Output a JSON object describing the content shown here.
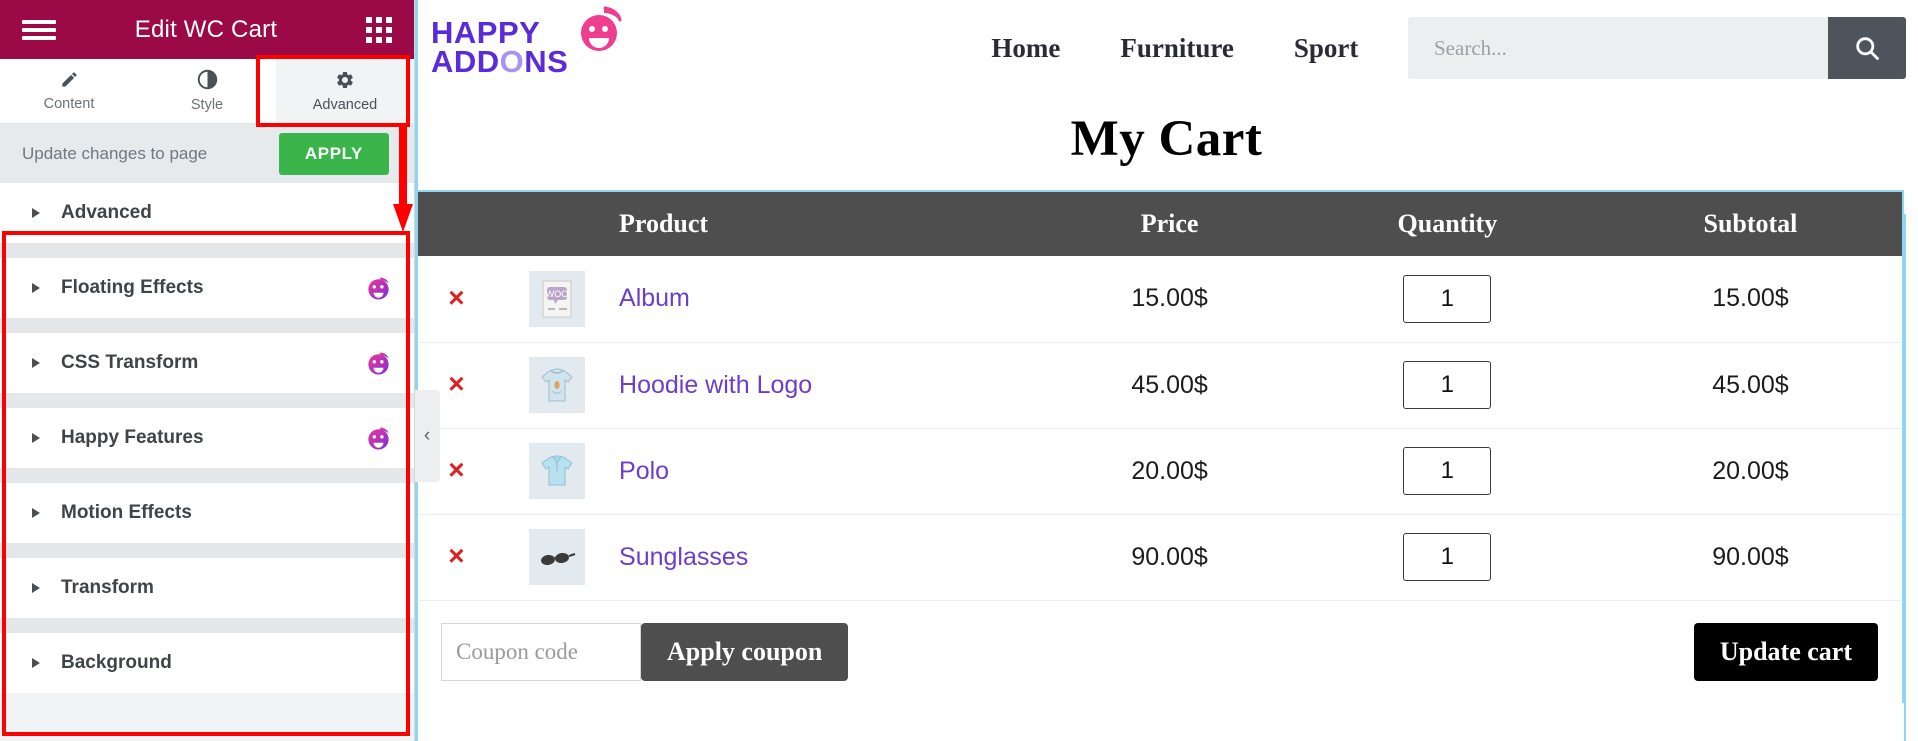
{
  "panel": {
    "header": {
      "title": "Edit WC Cart",
      "menu_icon": "hamburger-icon",
      "grid_icon": "grid-apps-icon"
    },
    "tabs": [
      {
        "label": "Content",
        "icon": "pencil-icon",
        "active": false
      },
      {
        "label": "Style",
        "icon": "contrast-half-circle-icon",
        "active": false
      },
      {
        "label": "Advanced",
        "icon": "gear-icon",
        "active": true
      }
    ],
    "apply_bar": {
      "label": "Update changes to page",
      "button": "APPLY"
    },
    "accordion": [
      {
        "label": "Advanced",
        "badge": false
      },
      {
        "label": "Floating Effects",
        "badge": true
      },
      {
        "label": "CSS Transform",
        "badge": true
      },
      {
        "label": "Happy Features",
        "badge": true
      },
      {
        "label": "Motion Effects",
        "badge": false
      },
      {
        "label": "Transform",
        "badge": false
      },
      {
        "label": "Background",
        "badge": false
      }
    ],
    "colors": {
      "header_bg": "#9b0a46",
      "apply_green": "#39b54a",
      "highlight": "#ff0000"
    }
  },
  "site": {
    "logo": {
      "line1": "HAPPY",
      "line2": "ADDONS",
      "face_icon": "happy-face-icon"
    },
    "nav": [
      {
        "label": "Home"
      },
      {
        "label": "Furniture"
      },
      {
        "label": "Sport"
      }
    ],
    "search": {
      "placeholder": "Search...",
      "value": "",
      "button_icon": "search-icon"
    }
  },
  "cart": {
    "title": "My Cart",
    "columns": [
      "",
      "",
      "Product",
      "Price",
      "Quantity",
      "Subtotal"
    ],
    "rows": [
      {
        "remove": "×",
        "thumb": "album-woo-icon",
        "name": "Album",
        "price": "15.00$",
        "qty": "1",
        "subtotal": "15.00$"
      },
      {
        "remove": "×",
        "thumb": "hoodie-icon",
        "name": "Hoodie with Logo",
        "price": "45.00$",
        "qty": "1",
        "subtotal": "45.00$"
      },
      {
        "remove": "×",
        "thumb": "polo-shirt-icon",
        "name": "Polo",
        "price": "20.00$",
        "qty": "1",
        "subtotal": "20.00$"
      },
      {
        "remove": "×",
        "thumb": "sunglasses-icon",
        "name": "Sunglasses",
        "price": "90.00$",
        "qty": "1",
        "subtotal": "90.00$"
      }
    ],
    "coupon": {
      "placeholder": "Coupon code",
      "value": "",
      "apply_label": "Apply coupon"
    },
    "update_label": "Update cart",
    "colors": {
      "header_bg": "#4e4e4e",
      "product_link": "#6c3fc9",
      "remove_x": "#e02020",
      "border": "#8ed6f2"
    }
  },
  "collapse_handle": {
    "icon": "chevron-left-icon",
    "glyph": "‹"
  }
}
